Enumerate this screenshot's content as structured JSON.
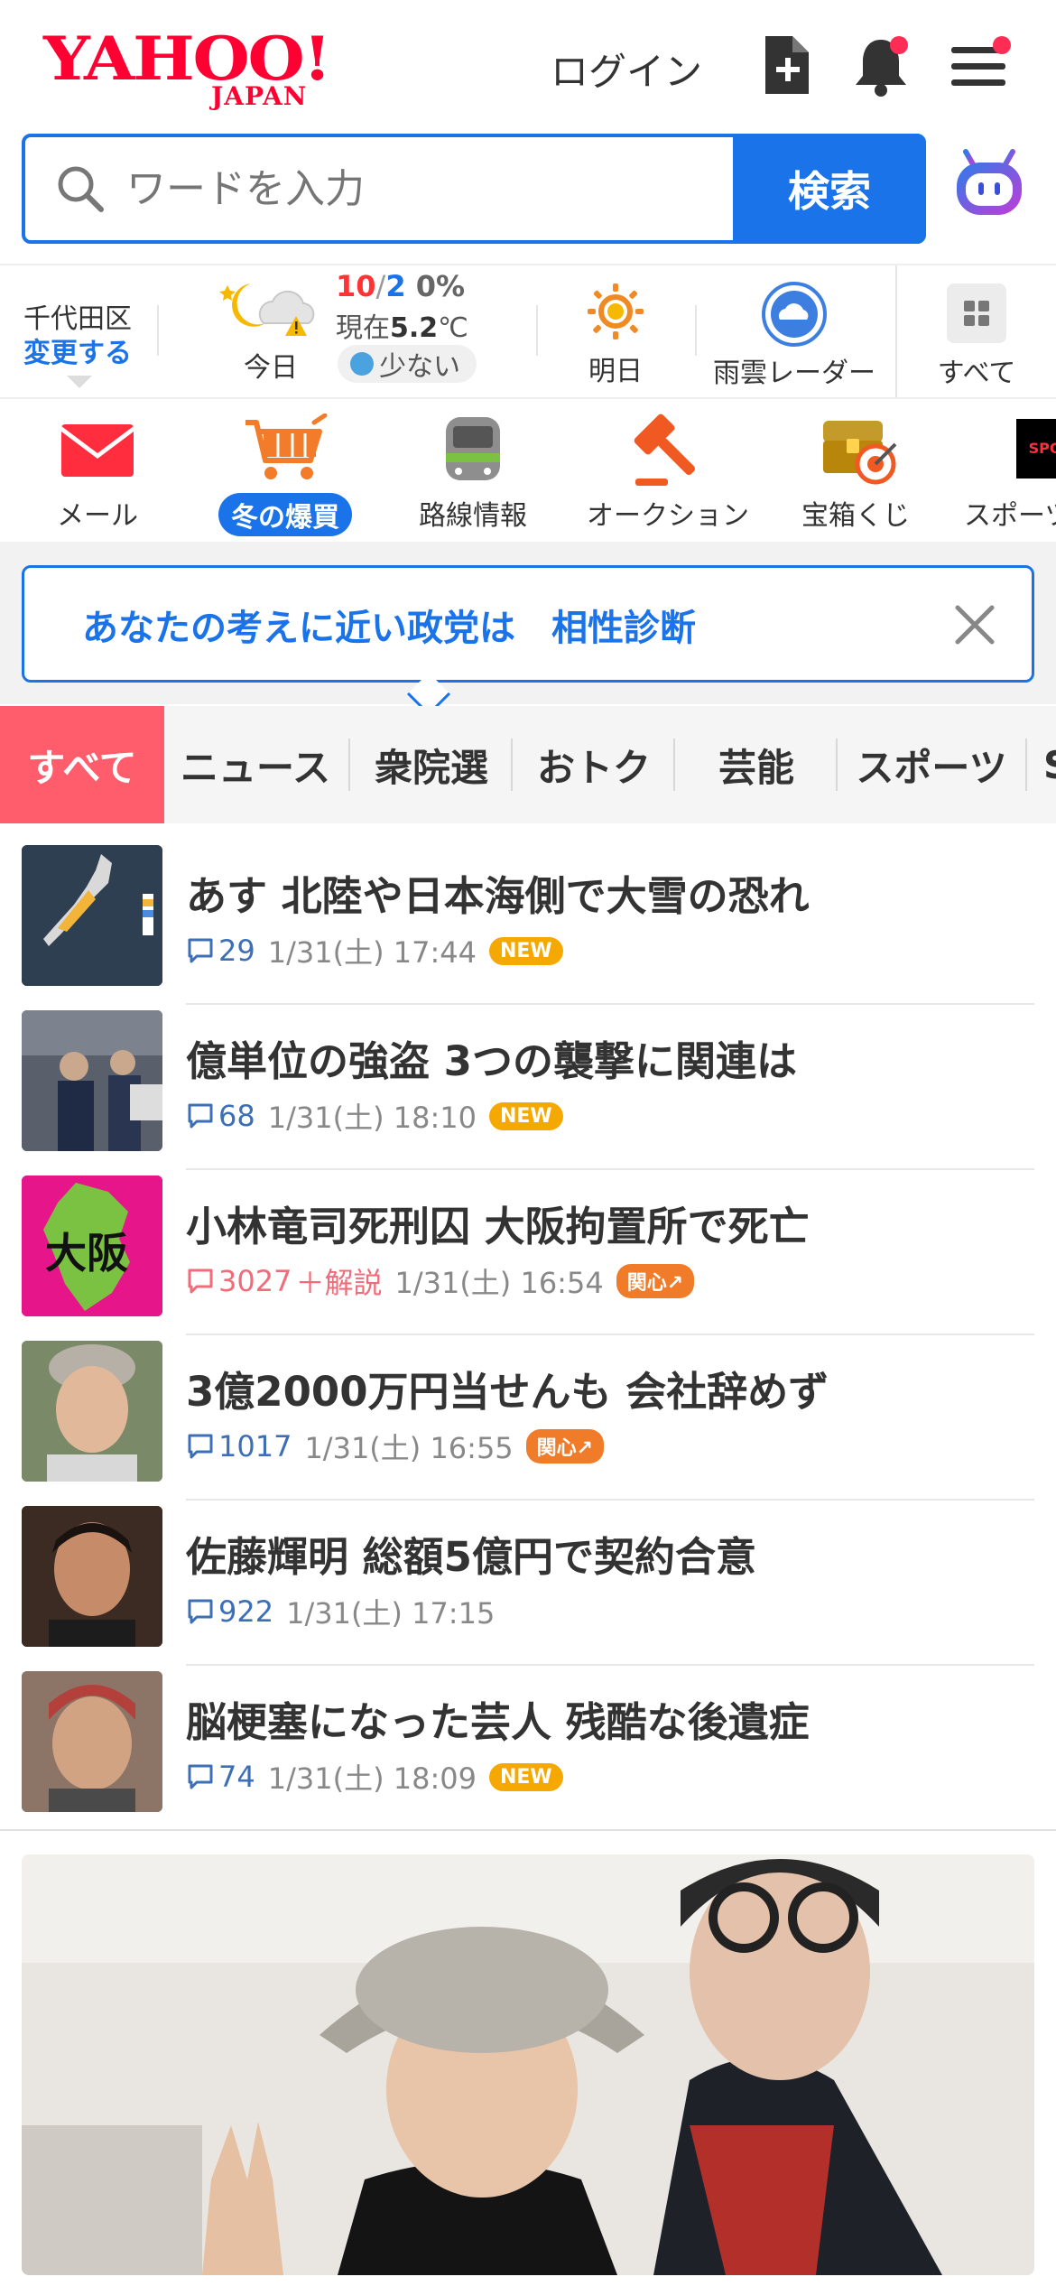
{
  "header": {
    "logo_main": "YAHOO!",
    "logo_sub": "JAPAN",
    "login_label": "ログイン"
  },
  "search": {
    "placeholder": "ワードを入力",
    "button_label": "検索"
  },
  "weather": {
    "location": "千代田区",
    "change_label": "変更する",
    "today_label": "今日",
    "high": "10",
    "low": "2",
    "precip": "0%",
    "now_prefix": "現在",
    "now_temp": "5.2",
    "now_unit": "℃",
    "pollen": "少ない",
    "tomorrow_label": "明日",
    "radar_label": "雨雲レーダー",
    "all_label": "すべて"
  },
  "services": [
    {
      "label": "メール"
    },
    {
      "label": "冬の爆買"
    },
    {
      "label": "路線情報"
    },
    {
      "label": "オークション"
    },
    {
      "label": "宝箱くじ"
    },
    {
      "label": "スポーツ"
    }
  ],
  "banner": {
    "text": "あなたの考えに近い政党は　相性診断"
  },
  "tabs": [
    "すべて",
    "ニュース",
    "衆院選",
    "おトク",
    "芸能",
    "スポーツ"
  ],
  "news": [
    {
      "title": "あす 北陸や日本海側で大雪の恐れ",
      "comments": "29",
      "date": "1/31(土) 17:44",
      "badge": "NEW"
    },
    {
      "title": "億単位の強盗 3つの襲撃に関連は",
      "comments": "68",
      "date": "1/31(土) 18:10",
      "badge": "NEW"
    },
    {
      "title": "小林竜司死刑囚 大阪拘置所で死亡",
      "comments": "3027",
      "extra": "＋解説",
      "date": "1/31(土) 16:54",
      "badge": "関心↗",
      "thumb_text": "大阪"
    },
    {
      "title": "3億2000万円当せんも 会社辞めず",
      "comments": "1017",
      "date": "1/31(土) 16:55",
      "badge": "関心↗"
    },
    {
      "title": "佐藤輝明 総額5億円で契約合意",
      "comments": "922",
      "date": "1/31(土) 17:15",
      "badge": ""
    },
    {
      "title": "脳梗塞になった芸人 残酷な後遺症",
      "comments": "74",
      "date": "1/31(土) 18:09",
      "badge": "NEW"
    }
  ]
}
